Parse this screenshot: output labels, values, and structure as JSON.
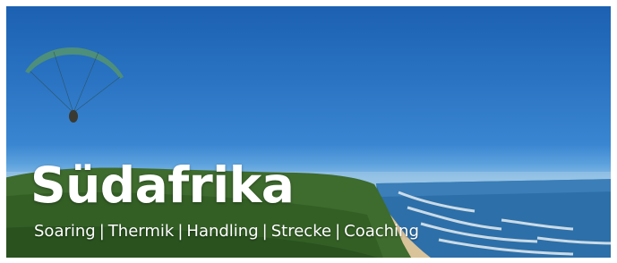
{
  "banner": {
    "title": "Südafrika",
    "subtitle_items": [
      "Soaring",
      "Thermik",
      "Handling",
      "Strecke",
      "Coaching"
    ],
    "separator": "|"
  },
  "photo": {
    "subject": "paraglider-icon",
    "colors": {
      "sky_top": "#1b5fb0",
      "sky_horizon": "#8fc0e6",
      "ocean": "#2d6fa8",
      "surf": "#dfe9ee",
      "hills": "#3e6b2e",
      "beach": "#d9c39a",
      "wing": "#4d8f7a"
    }
  }
}
